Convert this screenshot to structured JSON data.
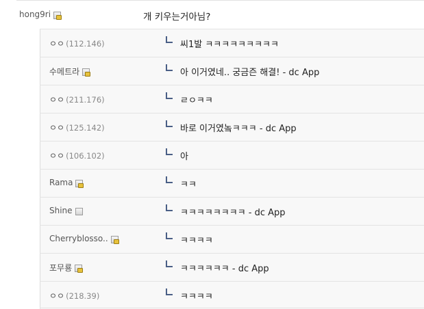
{
  "post": {
    "nickname": "hong9ri",
    "text": "개 키우는거아님?",
    "icon": "gallery-member-icon"
  },
  "replies": [
    {
      "nickname": "ㅇㅇ",
      "ip": "(112.146)",
      "text": "씨1발 ㅋㅋㅋㅋㅋㅋㅋㅋㅋ",
      "icon": ""
    },
    {
      "nickname": "수메트라",
      "ip": "",
      "text": "아 이거였네.. 궁금즌 해결! - dc App",
      "icon": "gallery-member-icon"
    },
    {
      "nickname": "ㅇㅇ",
      "ip": "(211.176)",
      "text": "ㄹㅇㅋㅋ",
      "icon": ""
    },
    {
      "nickname": "ㅇㅇ",
      "ip": "(125.142)",
      "text": "바로 이거였놐ㅋㅋㅋ - dc App",
      "icon": ""
    },
    {
      "nickname": "ㅇㅇ",
      "ip": "(106.102)",
      "text": "아",
      "icon": ""
    },
    {
      "nickname": "Rama",
      "ip": "",
      "text": "ㅋㅋ",
      "icon": "gallery-member-icon"
    },
    {
      "nickname": "Shine",
      "ip": "",
      "text": "ㅋㅋㅋㅋㅋㅋㅋㅋ - dc App",
      "icon": "fixed-nick-icon"
    },
    {
      "nickname": "Cherryblosso..",
      "ip": "",
      "text": "ㅋㅋㅋㅋ",
      "icon": "gallery-member-icon"
    },
    {
      "nickname": "포무룡",
      "ip": "",
      "text": "ㅋㅋㅋㅋㅋㅋ - dc App",
      "icon": "gallery-member-icon"
    },
    {
      "nickname": "ㅇㅇ",
      "ip": "(218.39)",
      "text": "ㅋㅋㅋㅋ",
      "icon": ""
    }
  ]
}
